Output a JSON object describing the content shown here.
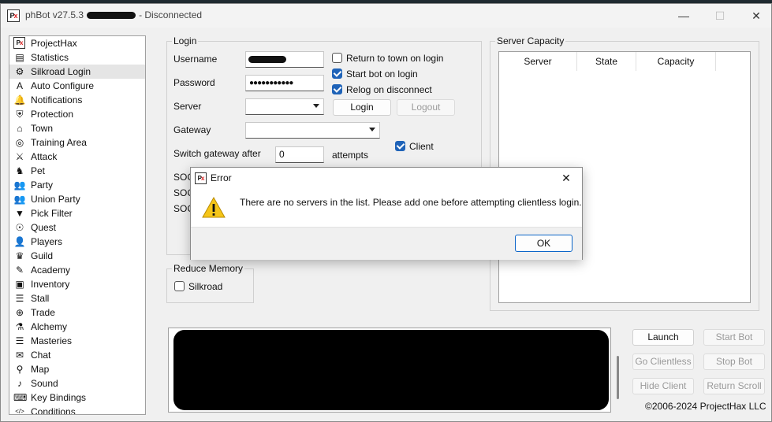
{
  "window": {
    "app_name": "phBot v27.5.3",
    "status": "- Disconnected",
    "icon_text": "P",
    "icon_text_x": "x"
  },
  "titlebar": {
    "minimize": "—",
    "maximize": "☐",
    "close": "✕"
  },
  "nav": {
    "items": [
      {
        "label": "ProjectHax",
        "icon": "projecthax-logo-icon"
      },
      {
        "label": "Statistics",
        "icon": "chart-icon"
      },
      {
        "label": "Silkroad Login",
        "icon": "gears-icon",
        "selected": true
      },
      {
        "label": "Auto Configure",
        "icon": "auto-a-icon"
      },
      {
        "label": "Notifications",
        "icon": "bell-icon"
      },
      {
        "label": "Protection",
        "icon": "shield-icon"
      },
      {
        "label": "Town",
        "icon": "town-icon"
      },
      {
        "label": "Training Area",
        "icon": "target-icon"
      },
      {
        "label": "Attack",
        "icon": "sword-icon"
      },
      {
        "label": "Pet",
        "icon": "pet-icon"
      },
      {
        "label": "Party",
        "icon": "party-icon"
      },
      {
        "label": "Union Party",
        "icon": "union-icon"
      },
      {
        "label": "Pick Filter",
        "icon": "filter-icon"
      },
      {
        "label": "Quest",
        "icon": "quest-icon"
      },
      {
        "label": "Players",
        "icon": "players-icon"
      },
      {
        "label": "Guild",
        "icon": "guild-icon"
      },
      {
        "label": "Academy",
        "icon": "academy-icon"
      },
      {
        "label": "Inventory",
        "icon": "inventory-icon"
      },
      {
        "label": "Stall",
        "icon": "stall-icon"
      },
      {
        "label": "Trade",
        "icon": "globe-icon"
      },
      {
        "label": "Alchemy",
        "icon": "alchemy-icon"
      },
      {
        "label": "Masteries",
        "icon": "books-icon"
      },
      {
        "label": "Chat",
        "icon": "chat-icon"
      },
      {
        "label": "Map",
        "icon": "map-pin-icon"
      },
      {
        "label": "Sound",
        "icon": "sound-icon"
      },
      {
        "label": "Key Bindings",
        "icon": "keyboard-icon"
      },
      {
        "label": "Conditions",
        "icon": "code-icon"
      }
    ]
  },
  "login": {
    "group_title": "Login",
    "username_label": "Username",
    "password_label": "Password",
    "password_value": "●●●●●●●●●●●",
    "server_label": "Server",
    "server_value": "",
    "gateway_label": "Gateway",
    "gateway_value": "",
    "switch_gateway_label": "Switch gateway after",
    "switch_gateway_value": "0",
    "attempts_label": "attempts",
    "return_to_town": {
      "label": "Return to town on login",
      "checked": false
    },
    "start_bot": {
      "label": "Start bot on login",
      "checked": true
    },
    "relog": {
      "label": "Relog on disconnect",
      "checked": true
    },
    "client": {
      "label": "Client",
      "checked": true
    },
    "login_button": "Login",
    "logout_button": "Logout",
    "socks_labels": [
      "SOCKS",
      "SOCKS",
      "SOCKS"
    ]
  },
  "reduce_memory": {
    "group_title": "Reduce Memory",
    "silkroad": {
      "label": "Silkroad",
      "checked": false
    }
  },
  "server_capacity": {
    "group_title": "Server Capacity",
    "columns": [
      "Server",
      "State",
      "Capacity"
    ]
  },
  "controls": {
    "launch": "Launch",
    "start_bot": "Start Bot",
    "go_clientless": "Go Clientless",
    "stop_bot": "Stop Bot",
    "hide_client": "Hide Client",
    "return_scroll": "Return Scroll"
  },
  "copyright": "©2006-2024 ProjectHax LLC",
  "dialog": {
    "title": "Error",
    "message": "There are no servers in the list. Please add one before attempting clientless login.",
    "ok": "OK",
    "close": "✕"
  },
  "colors": {
    "accent": "#1f63b8",
    "ok_border": "#0a64c8",
    "warning": "#f5c518"
  }
}
